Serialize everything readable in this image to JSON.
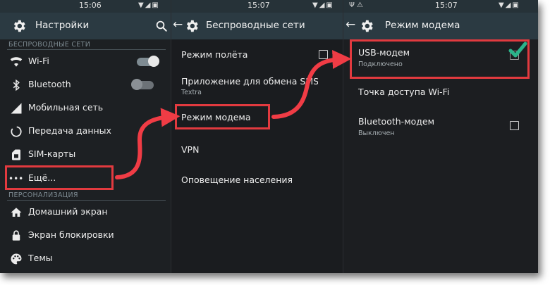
{
  "panel1": {
    "time": "15:06",
    "title": "Настройки",
    "section_wireless": "БЕСПРОВОДНЫЕ СЕТИ",
    "items": [
      {
        "label": "Wi-Fi",
        "icon": "wifi-icon"
      },
      {
        "label": "Bluetooth",
        "icon": "bluetooth-icon"
      },
      {
        "label": "Мобильная сеть",
        "icon": "signal-icon"
      },
      {
        "label": "Передача данных",
        "icon": "data-usage-icon"
      },
      {
        "label": "SIM-карты",
        "icon": "sim-card-icon"
      },
      {
        "label": "Ещё...",
        "icon": "more-dots-icon"
      }
    ],
    "section_personal": "ПЕРСОНАЛИЗАЦИЯ",
    "items2": [
      {
        "label": "Домашний экран",
        "icon": "home-icon"
      },
      {
        "label": "Экран блокировки",
        "icon": "lock-icon"
      },
      {
        "label": "Темы",
        "icon": "palette-icon"
      }
    ],
    "wifi_enabled": true,
    "bluetooth_enabled": false
  },
  "panel2": {
    "time": "15:07",
    "title": "Беспроводные сети",
    "items": [
      {
        "label": "Режим полёта"
      },
      {
        "label": "Приложение для обмена SMS",
        "sub": "Textra"
      },
      {
        "label": "Режим модема"
      },
      {
        "label": "VPN"
      },
      {
        "label": "Оповещение населения"
      }
    ],
    "airplane_checked": false
  },
  "panel3": {
    "time": "15:07",
    "title": "Режим модема",
    "items": [
      {
        "label": "USB-модем",
        "sub": "Подключено"
      },
      {
        "label": "Точка доступа Wi-Fi"
      },
      {
        "label": "Bluetooth-модем",
        "sub": "Выключен"
      }
    ],
    "usb_checked": true,
    "bt_checked": false
  },
  "colors": {
    "highlight": "#e23a3f",
    "arrow": "#f03c45",
    "check": "#2bb38a",
    "appbar": "#2b3a42"
  }
}
